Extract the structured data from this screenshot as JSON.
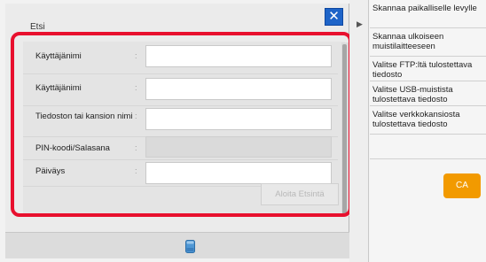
{
  "dialog": {
    "title": "Etsi",
    "close_label": "✕",
    "fields": [
      {
        "label": "Käyttäjänimi",
        "value": ""
      },
      {
        "label": "Käyttäjänimi",
        "value": ""
      },
      {
        "label": "Tiedoston tai kansion nimi",
        "value": ""
      },
      {
        "label": "PIN-koodi/Salasana",
        "value": ""
      },
      {
        "label": "Päiväys",
        "value": ""
      }
    ],
    "separator": ":",
    "search_button": "Aloita Etsintä"
  },
  "side_menu": {
    "items": [
      {
        "label": "Skannaa paikalliselle levylle"
      },
      {
        "label": "Skannaa ulkoiseen muistilaitteeseen"
      },
      {
        "label": "Valitse FTP:ltä tulostettava tiedosto"
      },
      {
        "label": "Valitse USB-muistista tulostettava tiedosto"
      },
      {
        "label": "Valitse verkkokansiosta tulostettava tiedosto"
      }
    ],
    "ca_button": "CA"
  },
  "colors": {
    "highlight": "#e8102e",
    "close_button": "#1e64c8",
    "ca_button": "#f29a00"
  },
  "icons": {
    "drive": "storage-drive-icon",
    "expand": "expand-panel-icon"
  }
}
